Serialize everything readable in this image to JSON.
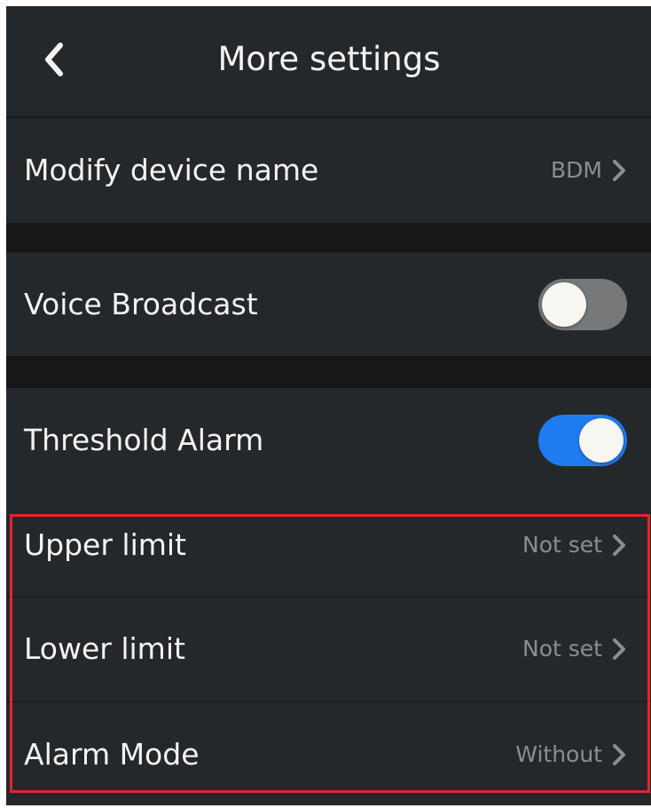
{
  "header": {
    "title": "More settings",
    "back_icon": "chevron-left-icon"
  },
  "rows": [
    {
      "id": "modify-device-name",
      "label": "Modify device name",
      "value": "BDM"
    },
    {
      "id": "voice-broadcast",
      "label": "Voice Broadcast",
      "toggle": false
    },
    {
      "id": "threshold-alarm",
      "label": "Threshold Alarm",
      "toggle": true
    },
    {
      "id": "upper-limit",
      "label": "Upper limit",
      "value": "Not set"
    },
    {
      "id": "lower-limit",
      "label": "Lower limit",
      "value": "Not set"
    },
    {
      "id": "alarm-mode",
      "label": "Alarm Mode",
      "value": "Without"
    }
  ],
  "colors": {
    "background": "#151719",
    "row": "#25282b",
    "text": "#f2f3f4",
    "value_text": "#8a8d91",
    "toggle_on": "#1e7cf0",
    "toggle_off": "#777879",
    "highlight": "#e2262d"
  }
}
